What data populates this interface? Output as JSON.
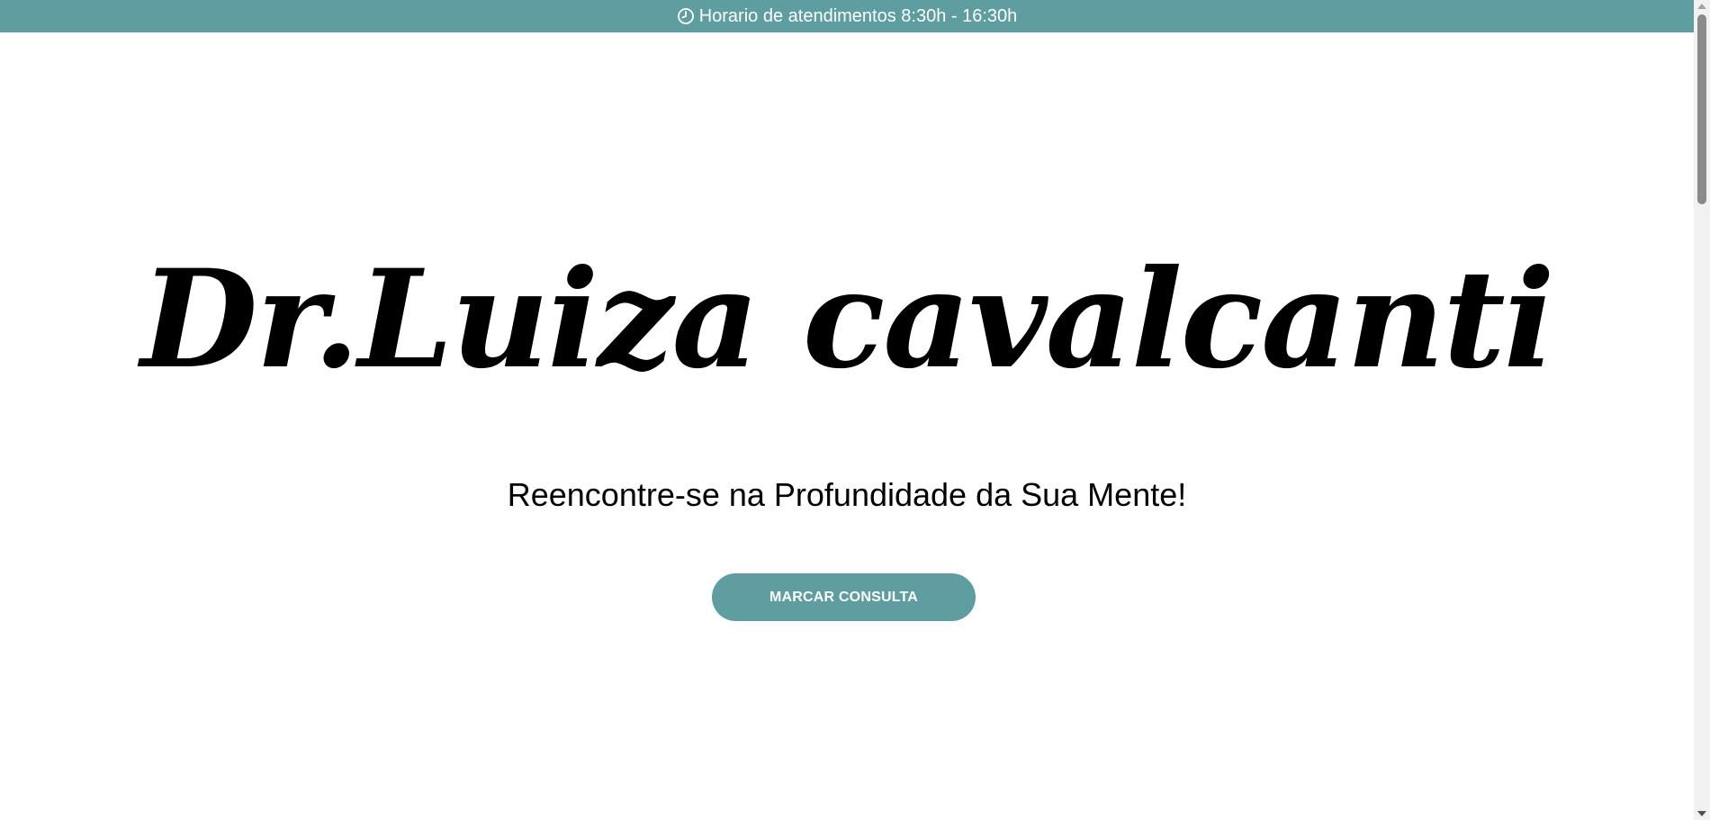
{
  "colors": {
    "accent": "#5f9ea0",
    "background": "#ffffff",
    "text": "#000000"
  },
  "topbar": {
    "icon": "clock-icon",
    "text": "Horario de atendimentos 8:30h - 16:30h"
  },
  "hero": {
    "title": "Dr.Luiza cavalcanti",
    "subtitle": "Reencontre-se na Profundidade da Sua Mente!",
    "cta_label": "MARCAR CONSULTA"
  },
  "scrollbar": {
    "position": 0
  }
}
